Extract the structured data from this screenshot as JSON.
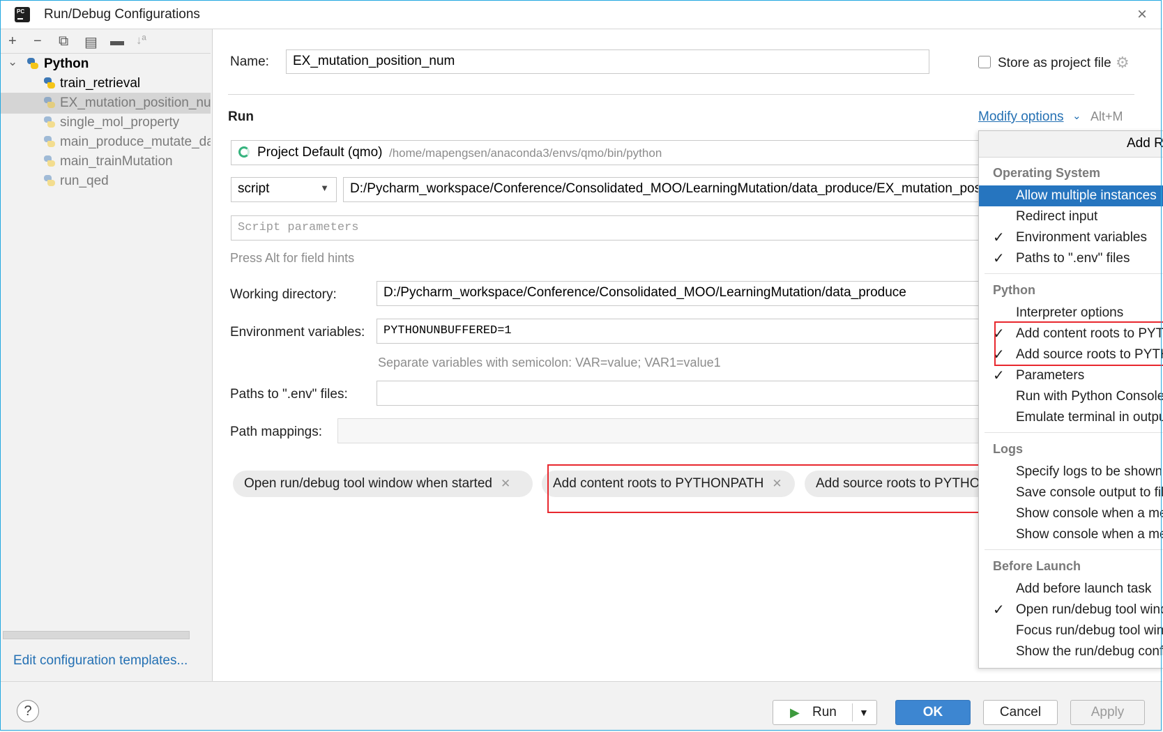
{
  "window": {
    "title": "Run/Debug Configurations",
    "close_glyph": "×",
    "app_icon_label": "PC"
  },
  "left_toolbar": {
    "add": "+",
    "remove": "−",
    "copy": "⧉",
    "save": "▤",
    "folder": "▬",
    "sort": "↓ª"
  },
  "tree": {
    "root": {
      "label": "Python"
    },
    "items": [
      {
        "label": "train_retrieval"
      },
      {
        "label": "EX_mutation_position_num"
      },
      {
        "label": "single_mol_property"
      },
      {
        "label": "main_produce_mutate_data"
      },
      {
        "label": "main_trainMutation"
      },
      {
        "label": "run_qed"
      }
    ]
  },
  "edit_templates_link": "Edit configuration templates...",
  "form": {
    "name_label": "Name:",
    "name_value": "EX_mutation_position_num",
    "store_label": "Store as project file",
    "run_section": "Run",
    "modify_options": "Modify options",
    "modify_shortcut": "Alt+M",
    "interpreter_name": "Project Default (qmo)",
    "interpreter_path": "/home/mapengsen/anaconda3/envs/qmo/bin/python",
    "script_type": "script",
    "script_path": "D:/Pycharm_workspace/Conference/Consolidated_MOO/LearningMutation/data_produce/EX_mutation_position_num.py",
    "script_params_placeholder": "Script parameters",
    "field_hint": "Press Alt for field hints",
    "working_dir_label": "Working directory:",
    "working_dir_value": "D:/Pycharm_workspace/Conference/Consolidated_MOO/LearningMutation/data_produce",
    "env_label": "Environment variables:",
    "env_value": "PYTHONUNBUFFERED=1",
    "env_hint": "Separate variables with semicolon: VAR=value; VAR1=value1",
    "paths_env_label": "Paths to \".env\" files:",
    "path_mappings_label": "Path mappings:"
  },
  "chips": [
    {
      "label": "Open run/debug tool window when started"
    },
    {
      "label": "Add content roots to PYTHONPATH"
    },
    {
      "label": "Add source roots to PYTHONPATH"
    }
  ],
  "popup": {
    "header": "Add Run Options",
    "sections": [
      {
        "title": "Operating System",
        "items": [
          {
            "label": "Allow multiple instances",
            "checked": false,
            "highlighted": true
          },
          {
            "label": "Redirect input",
            "checked": false
          },
          {
            "label": "Environment variables",
            "checked": true
          },
          {
            "label": "Paths to \".env\" files",
            "checked": true
          }
        ]
      },
      {
        "title": "Python",
        "items": [
          {
            "label": "Interpreter options",
            "checked": false
          },
          {
            "label": "Add content roots to PYTHONPATH",
            "checked": true
          },
          {
            "label": "Add source roots to PYTHONPATH",
            "checked": true
          },
          {
            "label": "Parameters",
            "checked": true
          },
          {
            "label": "Run with Python Console",
            "checked": false
          },
          {
            "label": "Emulate terminal in output console",
            "checked": false
          }
        ]
      },
      {
        "title": "Logs",
        "items": [
          {
            "label": "Specify logs to be shown in console",
            "checked": false
          },
          {
            "label": "Save console output to file",
            "checked": false
          },
          {
            "label": "Show console when a message is printed to stdout",
            "checked": false
          },
          {
            "label": "Show console when a message is printed to stderr",
            "checked": false
          }
        ]
      },
      {
        "title": "Before Launch",
        "items": [
          {
            "label": "Add before launch task",
            "checked": false
          },
          {
            "label": "Open run/debug tool window when started",
            "checked": true
          },
          {
            "label": "Focus run/debug tool window when started",
            "checked": false
          },
          {
            "label": "Show the run/debug configuration settings before start",
            "checked": false
          }
        ]
      }
    ],
    "check_glyph": "✓"
  },
  "buttons": {
    "help": "?",
    "run": "Run",
    "run_arrow": "▶",
    "run_dropdown": "▼",
    "ok": "OK",
    "cancel": "Cancel",
    "apply": "Apply"
  },
  "colors": {
    "accent": "#2675bf",
    "highlight_box": "#e8282e",
    "link": "#2470b3"
  }
}
